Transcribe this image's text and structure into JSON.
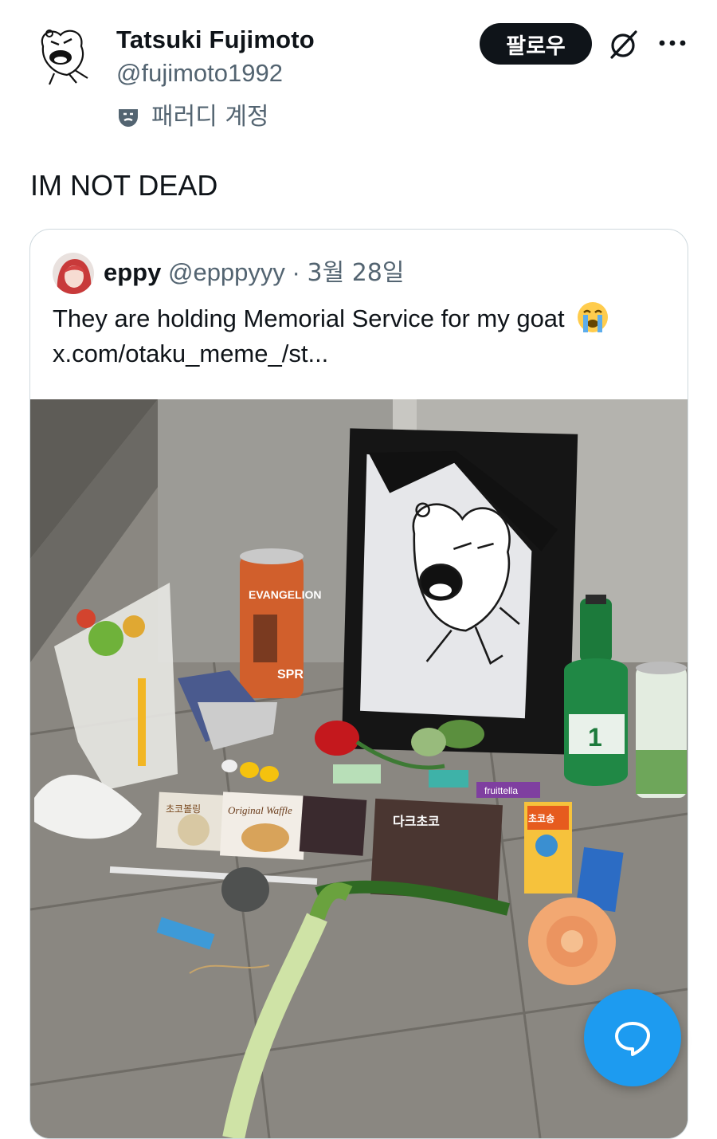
{
  "post": {
    "author_name": "Tatsuki Fujimoto",
    "author_handle": "@fujimoto1992",
    "parody_label": "패러디 계정",
    "follow_label": "팔로우",
    "text": "IM NOT DEAD"
  },
  "quote": {
    "name": "eppy",
    "handle": "@epppyyy",
    "separator": "·",
    "date": "3월 28일",
    "text": "They are holding Memorial Service for my goat",
    "link": "x.com/otaku_meme_/st...",
    "media_labels": {
      "can": "EVANGELION",
      "can_word": "SPR",
      "bottle_number": "1",
      "bag1": "초코볼링",
      "bag2": "Original Waffle",
      "bag3": "다크초코",
      "box": "초코송",
      "candy": "fruittella"
    }
  },
  "icons": {
    "avatar": "heart-character-avatar-icon",
    "parody": "theater-mask-icon",
    "grok": "grok-icon",
    "more": "more-dots-icon",
    "emoji": "crying-face-emoji-icon",
    "fab": "compose-reply-icon"
  },
  "colors": {
    "accent": "#1d9bf0",
    "text": "#0f1419",
    "secondary": "#536471",
    "border": "#cfd9de"
  }
}
